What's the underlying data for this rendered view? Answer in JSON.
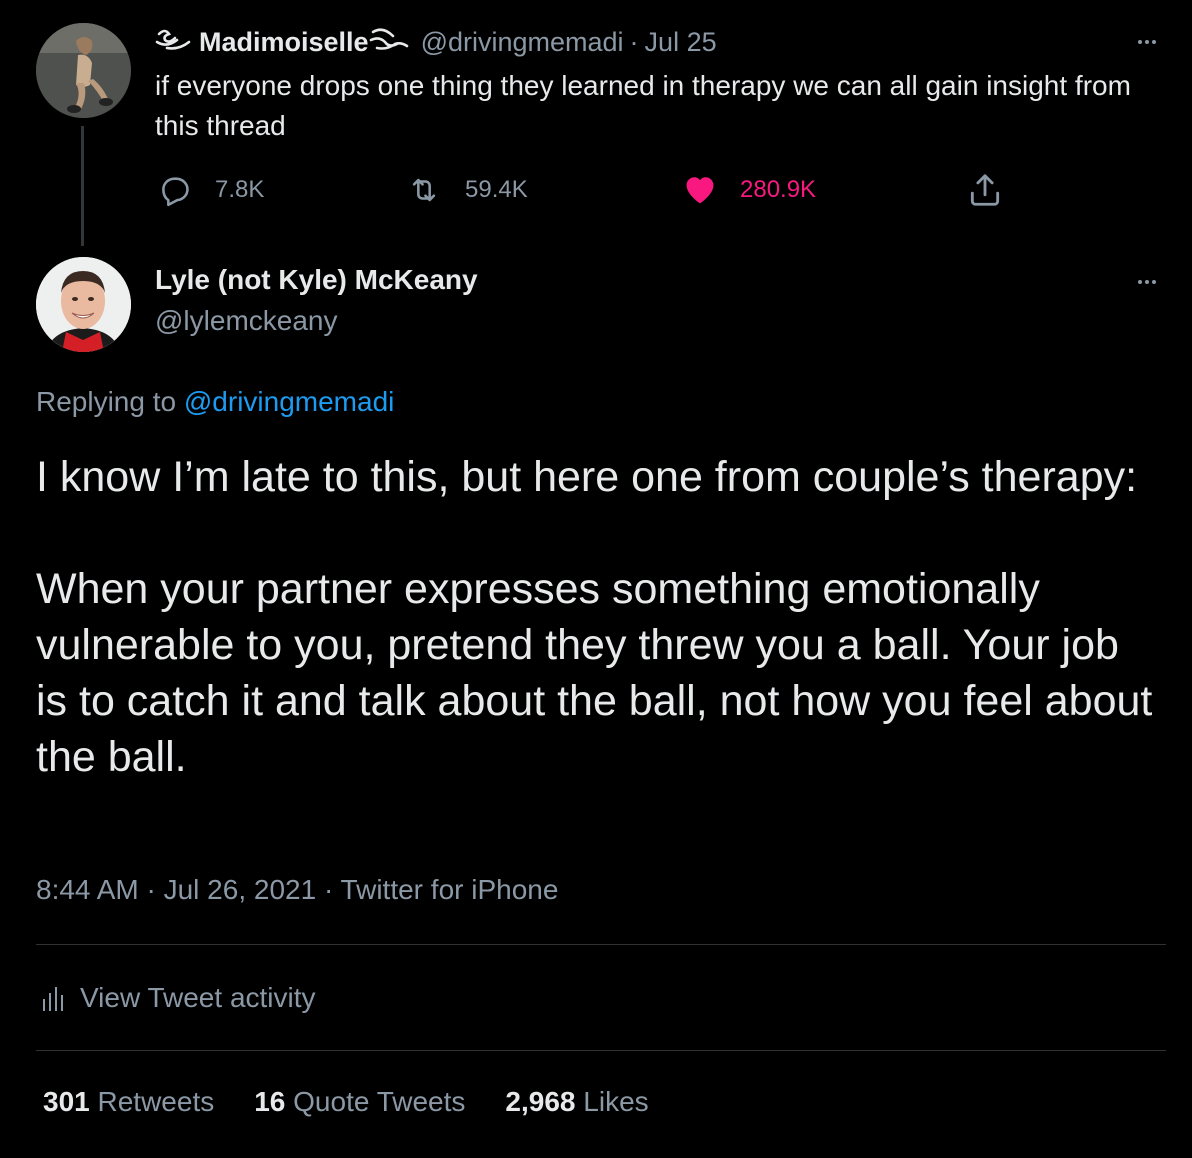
{
  "parent_tweet": {
    "display_name": "Madimoiselle",
    "display_name_prefix": "・࿔⹾",
    "handle": "@drivingmemadi",
    "separator": "·",
    "date": "Jul 25",
    "text": "if everyone drops one thing they learned in therapy we can all gain insight from this thread",
    "replies": "7.8K",
    "retweets": "59.4K",
    "likes": "280.9K",
    "liked": true
  },
  "main_tweet": {
    "display_name": "Lyle (not Kyle) McKeany",
    "handle": "@lylemckeany",
    "replying_label": "Replying to",
    "replying_mention": "@drivingmemadi",
    "paragraph_1": "I know I’m late to this, but here one from couple’s therapy:",
    "paragraph_2": "When your partner expresses something emotionally vulnerable to you, pretend they threw you a ball. Your job is to catch it and talk about the ball, not how you feel about the ball.",
    "meta": "8:44 AM · Jul 26, 2021 · Twitter for iPhone",
    "view_activity": "View Tweet activity",
    "retweets_count": "301",
    "retweets_label": "Retweets",
    "quote_count": "16",
    "quote_label": "Quote Tweets",
    "likes_count": "2,968",
    "likes_label": "Likes"
  },
  "colors": {
    "background": "#000000",
    "text": "#e7e9ea",
    "secondary": "#8b98a5",
    "link": "#1d9bf0",
    "like": "#f91880"
  }
}
